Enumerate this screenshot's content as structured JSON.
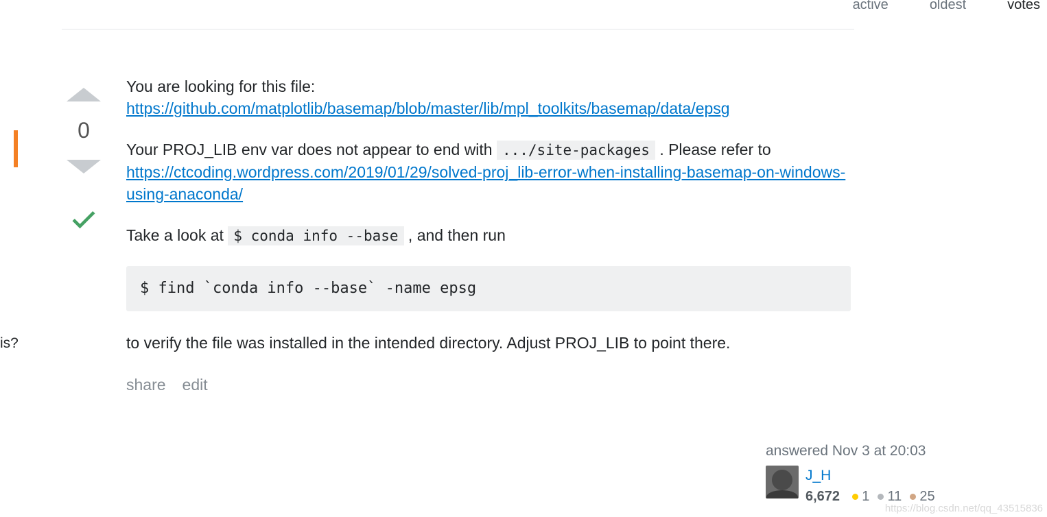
{
  "sort": {
    "active": "active",
    "oldest": "oldest",
    "votes": "votes"
  },
  "left": {
    "is": "is?"
  },
  "vote": {
    "score": "0"
  },
  "answer": {
    "intro": "You are looking for this file:",
    "link1": "https://github.com/matplotlib/basemap/blob/master/lib/mpl_toolkits/basemap/data/epsg",
    "p2a": "Your PROJ_LIB env var does not appear to end with ",
    "code1": ".../site-packages",
    "p2b": ". Please refer to ",
    "link2": "https://ctcoding.wordpress.com/2019/01/29/solved-proj_lib-error-when-installing-basemap-on-windows-using-anaconda/",
    "p3a": "Take a look at ",
    "code2": "$ conda info --base",
    "p3b": ", and then run",
    "codeblock": "$ find `conda info --base` -name epsg",
    "p4": "to verify the file was installed in the intended directory. Adjust PROJ_LIB to point there."
  },
  "actions": {
    "share": "share",
    "edit": "edit"
  },
  "user": {
    "answered": "answered Nov 3 at 20:03",
    "name": "J_H",
    "rep": "6,672",
    "gold": "1",
    "silver": "11",
    "bronze": "25"
  },
  "watermark": "https://blog.csdn.net/qq_43515836"
}
